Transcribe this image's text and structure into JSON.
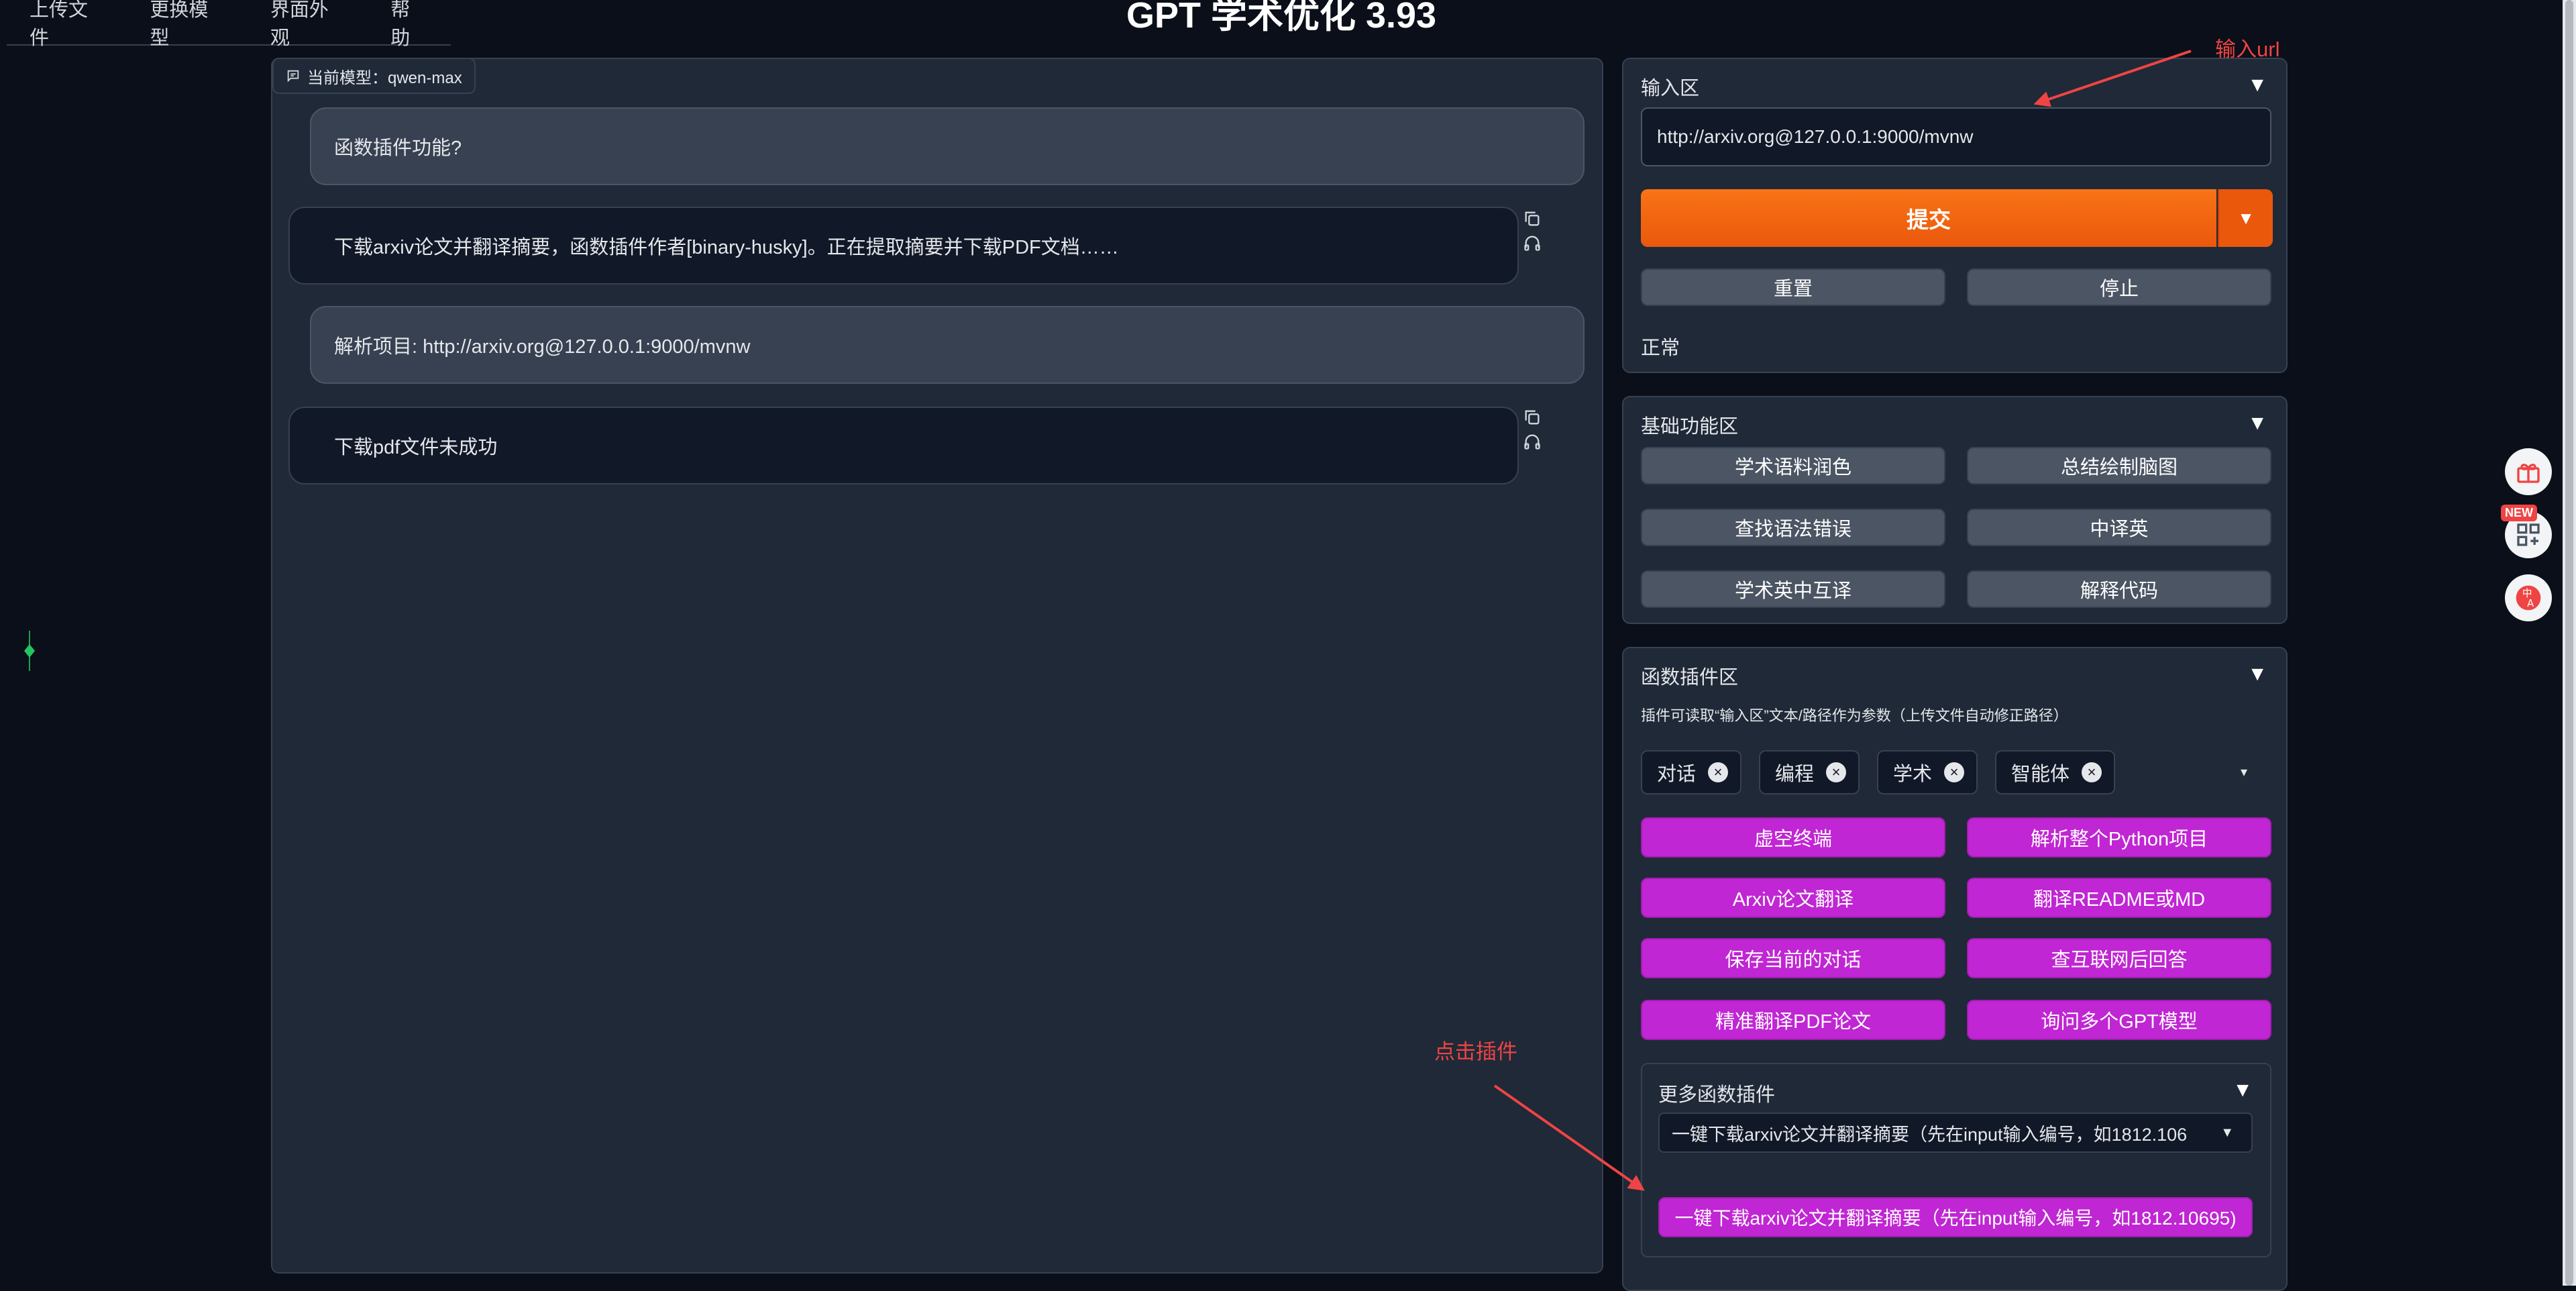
{
  "menu": [
    "上传文件",
    "更换模型",
    "界面外观",
    "帮助"
  ],
  "app_title": "GPT 学术优化 3.93",
  "model_badge": "当前模型：qwen-max",
  "chat": [
    {
      "role": "user",
      "text": "函数插件功能?"
    },
    {
      "role": "bot",
      "text": "下载arxiv论文并翻译摘要，函数插件作者[binary-husky]。正在提取摘要并下载PDF文档……"
    },
    {
      "role": "user",
      "text": "解析项目: http://arxiv.org@127.0.0.1:9000/mvnw"
    },
    {
      "role": "bot",
      "text": "下载pdf文件未成功"
    }
  ],
  "input_area": {
    "title": "输入区",
    "value": "http://arxiv.org@127.0.0.1:9000/mvnw",
    "submit": "提交",
    "reset": "重置",
    "stop": "停止",
    "status": "正常"
  },
  "basic": {
    "title": "基础功能区",
    "buttons": [
      "学术语料润色",
      "总结绘制脑图",
      "查找语法错误",
      "中译英",
      "学术英中互译",
      "解释代码"
    ]
  },
  "plugins": {
    "title": "函数插件区",
    "hint": "插件可读取“输入区”文本/路径作为参数（上传文件自动修正路径）",
    "tags": [
      "对话",
      "编程",
      "学术",
      "智能体"
    ],
    "buttons": [
      "虚空终端",
      "解析整个Python项目",
      "Arxiv论文翻译",
      "翻译README或MD",
      "保存当前的对话",
      "查互联网后回答",
      "精准翻译PDF论文",
      "询问多个GPT模型"
    ],
    "more_title": "更多函数插件",
    "more_selected": "一键下载arxiv论文并翻译摘要（先在input输入编号，如1812.106",
    "more_button": "一键下载arxiv论文并翻译摘要（先在input输入编号，如1812.10695)"
  },
  "annotations": {
    "input_url": "输入url",
    "click_plugin": "点击插件"
  },
  "badge_new": "NEW",
  "colors": {
    "background": "#0b0f19",
    "panel": "#1f2937",
    "submit": "#f97316",
    "plugin_button": "#c026d3",
    "annotation": "#ef4444"
  },
  "icons": {
    "chat": "chat-bubble-icon",
    "copy": "copy-icon",
    "audio": "headphones-icon",
    "gift": "gift-icon",
    "apps": "apps-grid-icon",
    "translate": "translate-icon"
  }
}
